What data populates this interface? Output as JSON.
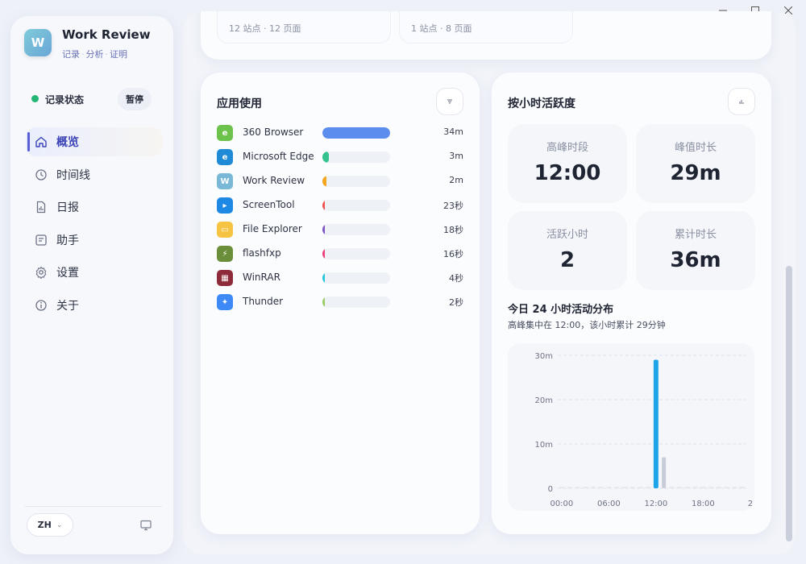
{
  "window": {
    "minimize": "—",
    "maximize": "☐",
    "close": "✕"
  },
  "sidebar": {
    "app_title": "Work Review",
    "subtitle_parts": [
      "记录",
      "分析",
      "证明"
    ],
    "logo_text": "W",
    "status_label": "记录状态",
    "status_color": "#22b573",
    "pause_label": "暂停",
    "items": [
      {
        "label": "概览",
        "icon": "home-icon",
        "active": true
      },
      {
        "label": "时间线",
        "icon": "clock-icon",
        "active": false
      },
      {
        "label": "日报",
        "icon": "report-icon",
        "active": false
      },
      {
        "label": "助手",
        "icon": "assistant-icon",
        "active": false
      },
      {
        "label": "设置",
        "icon": "gear-icon",
        "active": false
      },
      {
        "label": "关于",
        "icon": "info-icon",
        "active": false
      }
    ],
    "lang": "ZH",
    "lang_chevron": "⌄"
  },
  "top_cards": [
    {
      "text": "12 站点 · 12 页面"
    },
    {
      "text": "1 站点 · 8 页面"
    }
  ],
  "app_usage": {
    "title": "应用使用",
    "items": [
      {
        "name": "360 Browser",
        "duration": "34m",
        "fraction": 1.0,
        "color": "#5b8def",
        "icon_color": "#6cc24a",
        "icon_text": "e"
      },
      {
        "name": "Microsoft Edge",
        "duration": "3m",
        "fraction": 0.09,
        "color": "#34c38f",
        "icon_color": "#1f8ad6",
        "icon_text": "e"
      },
      {
        "name": "Work Review",
        "duration": "2m",
        "fraction": 0.06,
        "color": "#f5a623",
        "icon_color": "#7ab8d8",
        "icon_text": "W"
      },
      {
        "name": "ScreenTool",
        "duration": "23秒",
        "fraction": 0.012,
        "color": "#ef5350",
        "icon_color": "#1e88e5",
        "icon_text": "▸"
      },
      {
        "name": "File Explorer",
        "duration": "18秒",
        "fraction": 0.009,
        "color": "#7e57c2",
        "icon_color": "#f6c343",
        "icon_text": "▭"
      },
      {
        "name": "flashfxp",
        "duration": "16秒",
        "fraction": 0.008,
        "color": "#ec407a",
        "icon_color": "#6b8e3a",
        "icon_text": "⚡"
      },
      {
        "name": "WinRAR",
        "duration": "4秒",
        "fraction": 0.002,
        "color": "#26c6da",
        "icon_color": "#8e2b3a",
        "icon_text": "▦"
      },
      {
        "name": "Thunder",
        "duration": "2秒",
        "fraction": 0.001,
        "color": "#9ccc65",
        "icon_color": "#3d8af7",
        "icon_text": "✦"
      }
    ]
  },
  "hourly": {
    "title": "按小时活跃度",
    "stats": [
      {
        "label": "高峰时段",
        "value": "12:00"
      },
      {
        "label": "峰值时长",
        "value": "29m"
      },
      {
        "label": "活跃小时",
        "value": "2"
      },
      {
        "label": "累计时长",
        "value": "36m"
      }
    ],
    "dist_title": "今日 24 小时活动分布",
    "dist_subtitle": "高峰集中在 12:00，该小时累计 29分钟"
  },
  "chart_data": {
    "type": "bar",
    "x_tick_labels": [
      "00:00",
      "06:00",
      "12:00",
      "18:00",
      "2"
    ],
    "y_tick_labels": [
      "0",
      "10m",
      "20m",
      "30m"
    ],
    "ylim": [
      0,
      30
    ],
    "hours": [
      0,
      1,
      2,
      3,
      4,
      5,
      6,
      7,
      8,
      9,
      10,
      11,
      12,
      13,
      14,
      15,
      16,
      17,
      18,
      19,
      20,
      21,
      22,
      23
    ],
    "values": [
      0,
      0,
      0,
      0,
      0,
      0,
      0,
      0,
      0,
      0,
      0,
      0,
      29,
      7,
      0,
      0,
      0,
      0,
      0,
      0,
      0,
      0,
      0,
      0
    ],
    "highlight_hour": 12,
    "highlight_color": "#1ea4e9",
    "bar_color": "#c7ccd8",
    "grid": true
  }
}
